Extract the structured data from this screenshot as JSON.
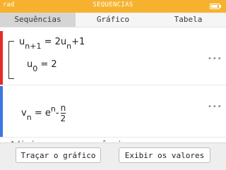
{
  "statusbar": {
    "angle_mode": "rad",
    "title": "SEQUENCIAS"
  },
  "tabs": [
    {
      "label": "Sequências",
      "active": true
    },
    {
      "label": "Gráfico",
      "active": false
    },
    {
      "label": "Tabela",
      "active": false
    }
  ],
  "sequences": [
    {
      "color": "#e32a28",
      "definition": {
        "lhs_base": "u",
        "lhs_sub": "n+1",
        "rhs_coef": "= 2u",
        "rhs_sub": "n",
        "rhs_tail": "+1"
      },
      "initial": {
        "base": "u",
        "sub": "0",
        "rhs": "= 2"
      }
    },
    {
      "color": "#3e74e3",
      "definition": {
        "lhs_base": "v",
        "lhs_sub": "n",
        "rhs_base": "= e",
        "rhs_sup": "n",
        "minus": "-",
        "frac_num": "n",
        "frac_den": "2"
      }
    }
  ],
  "more_options_icon": "ellipsis-icon",
  "add_sequence_label": "Adicionar uma sequência",
  "buttons": {
    "plot_label": "Traçar o gráfico",
    "values_label": "Exibir os valores"
  },
  "colors": {
    "statusbar": "#f6b22f",
    "active_tab": "#d5d5d5"
  }
}
